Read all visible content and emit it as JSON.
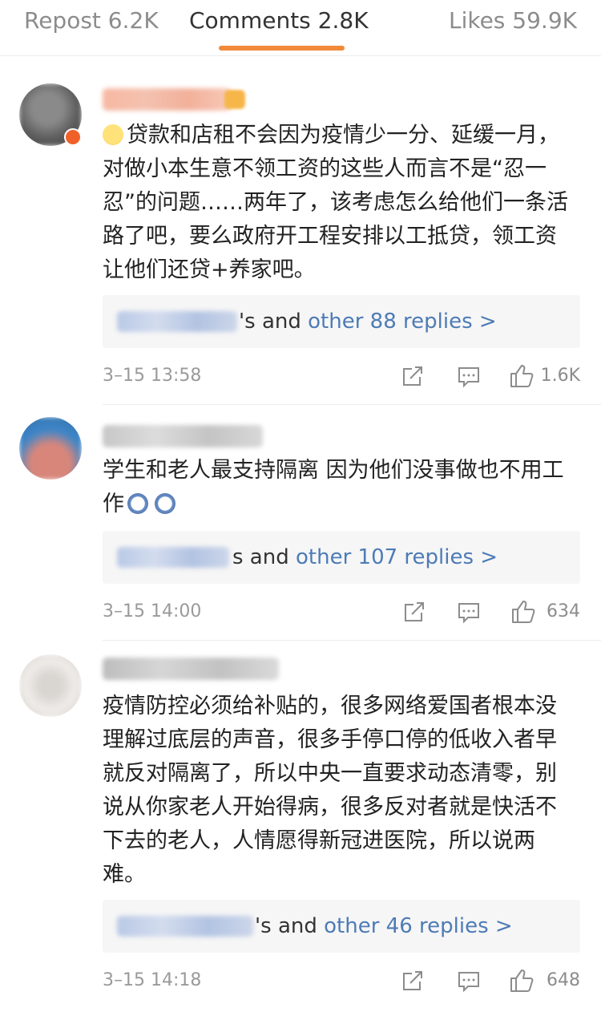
{
  "tabs": {
    "repost": "Repost 6.2K",
    "comments": "Comments 2.8K",
    "likes": "Likes 59.9K",
    "active_color": "#f28a3a"
  },
  "comments": [
    {
      "text": "贷款和店租不会因为疫情少一分、延缓一月，对做小本生意不领工资的这些人而言不是“忍一忍”的问题……两年了，该考虑怎么给他们一条活路了吧，要么政府开工程安排以工抵贷，领工资让他们还贷+养家吧。",
      "lead_emoji": "sad-face-icon",
      "replies_suffix": "'s and",
      "replies_link": "other 88 replies >",
      "time": "3–15 13:58",
      "likes": "1.6K"
    },
    {
      "text": "学生和老人最支持隔离 因为他们没事做也不用工作",
      "trail_emoji": "panda-crying-icon",
      "replies_suffix": "s and",
      "replies_link": "other 107 replies >",
      "time": "3–15 14:00",
      "likes": "634"
    },
    {
      "text": "疫情防控必须给补贴的，很多网络爱国者根本没理解过底层的声音，很多手停口停的低收入者早就反对隔离了，所以中央一直要求动态清零，别说从你家老人开始得病，很多反对者就是快活不下去的老人，人情愿得新冠进医院，所以说两难。",
      "replies_suffix": "'s and",
      "replies_link": "other 46 replies >",
      "time": "3–15 14:18",
      "likes": "648"
    }
  ],
  "colors": {
    "link": "#4d7bb6",
    "muted": "#9a9a9a"
  }
}
